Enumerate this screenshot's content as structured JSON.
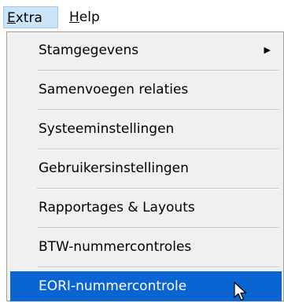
{
  "menubar": {
    "extra_mnemonic": "E",
    "extra_rest": "xtra",
    "help_mnemonic": "H",
    "help_rest": "elp"
  },
  "menu": {
    "items": [
      {
        "label": "Stamgegevens",
        "has_submenu": true
      },
      {
        "label": "Samenvoegen relaties"
      },
      {
        "label": "Systeeminstellingen"
      },
      {
        "label": "Gebruikersinstellingen"
      },
      {
        "label": "Rapportages & Layouts"
      },
      {
        "label": "BTW-nummercontroles"
      },
      {
        "label": "EORI-nummercontrole",
        "highlighted": true
      }
    ],
    "submenu_arrow": "▶"
  },
  "icons": {
    "submenu": "submenu-arrow-icon",
    "cursor": "mouse-pointer-icon"
  },
  "colors": {
    "highlight": "#0a64d2",
    "menubar_active": "#cce4f7",
    "menu_background": "#f0f0f0"
  }
}
